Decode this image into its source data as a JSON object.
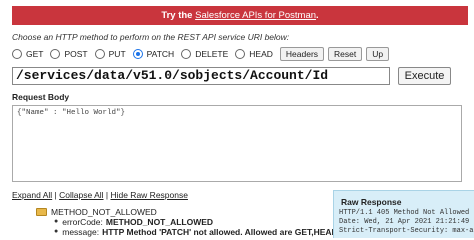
{
  "banner": {
    "prefix": "Try the ",
    "link": "Salesforce APIs for Postman",
    "suffix": "."
  },
  "instruction": "Choose an HTTP method to perform on the REST API service URI below:",
  "methods": [
    {
      "label": "GET",
      "selected": false
    },
    {
      "label": "POST",
      "selected": false
    },
    {
      "label": "PUT",
      "selected": false
    },
    {
      "label": "PATCH",
      "selected": true
    },
    {
      "label": "DELETE",
      "selected": false
    },
    {
      "label": "HEAD",
      "selected": false
    }
  ],
  "buttons": {
    "headers": "Headers",
    "reset": "Reset",
    "up": "Up"
  },
  "uri": "/services/data/v51.0/sobjects/Account/Id",
  "execute": "Execute",
  "request_body": {
    "label": "Request Body",
    "value": "{\"Name\" : \"Hello World\"}"
  },
  "links": {
    "expand": "Expand All",
    "collapse": "Collapse All",
    "hide_raw": "Hide Raw Response",
    "sep": " | "
  },
  "result": {
    "root": "METHOD_NOT_ALLOWED",
    "error_code_key": "errorCode:",
    "error_code_val": "METHOD_NOT_ALLOWED",
    "message_key": "message:",
    "message_val": "HTTP Method 'PATCH' not allowed. Allowed are GET,HEAD"
  },
  "raw_response": {
    "title": "Raw Response",
    "lines": [
      "HTTP/1.1 405 Method Not Allowed",
      "Date: Wed, 21 Apr 2021 21:21:49",
      "Strict-Transport-Security: max-a"
    ]
  }
}
